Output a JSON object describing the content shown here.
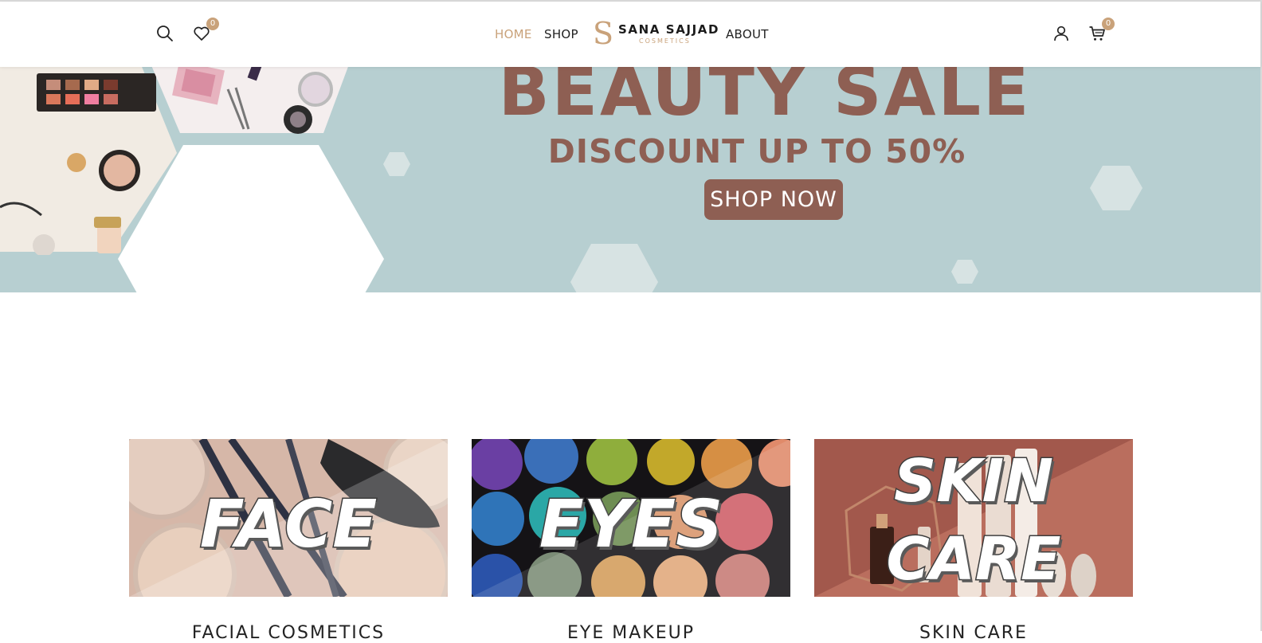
{
  "header": {
    "wishlist_count": "0",
    "cart_count": "0",
    "nav": {
      "home": "HOME",
      "shop": "SHOP",
      "about": "ABOUT"
    },
    "logo": {
      "mark": "S",
      "name": "SANA SAJJAD",
      "tagline": "COSMETICS"
    },
    "icons": {
      "search": "search-icon",
      "wishlist": "heart-icon",
      "account": "user-icon",
      "cart": "cart-icon"
    }
  },
  "hero": {
    "title": "BEAUTY SALE",
    "subtitle": "DISCOUNT UP TO 50%",
    "cta": "SHOP NOW"
  },
  "categories": [
    {
      "label": "FACE",
      "caption": "FACIAL COSMETICS"
    },
    {
      "label_line1": "EYES",
      "caption": "EYE MAKEUP"
    },
    {
      "label_line1": "SKIN",
      "label_line2": "CARE",
      "caption": "SKIN CARE"
    }
  ],
  "colors": {
    "accent": "#c9a27a",
    "hero_bg": "#b7cfd1",
    "hero_text": "#8e5f53"
  }
}
